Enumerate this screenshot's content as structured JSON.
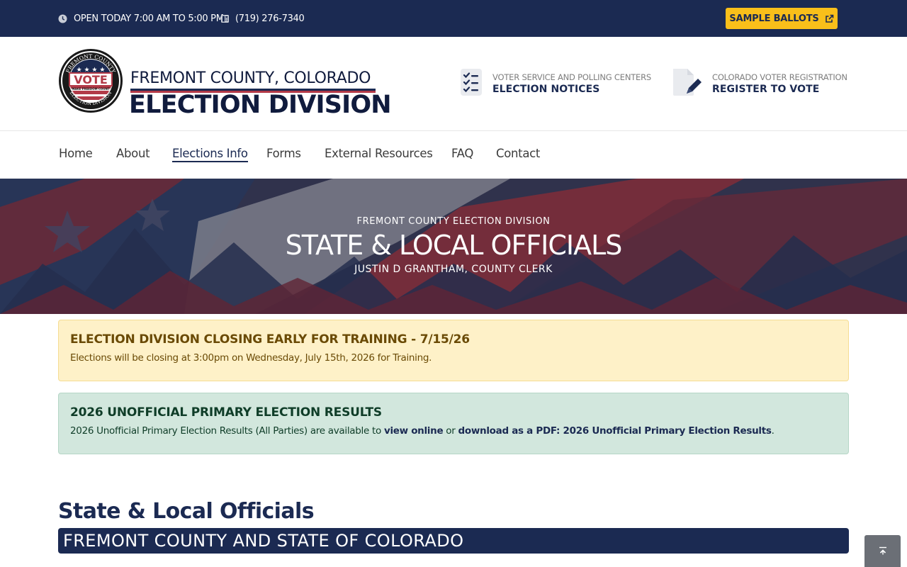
{
  "topbar": {
    "hours": "OPEN TODAY 7:00 AM TO 5:00 PM",
    "phone": "(719) 276-7340",
    "sample_ballots": "SAMPLE BALLOTS",
    "clock_icon": "clock-icon",
    "phone_icon": "phone-icon",
    "external_icon": "external-link-icon"
  },
  "header": {
    "seal": {
      "top_text": "FREMONT COUNTY",
      "vote": "VOTE",
      "motto": "MAKE FREEDOM COUNT",
      "bottom_text": "ELECTION DIVISION"
    },
    "logo_line1": "FREMONT COUNTY, COLORADO",
    "logo_line2": "ELECTION DIVISION",
    "notices": {
      "caption": "VOTER SERVICE AND POLLING CENTERS",
      "label": "ELECTION NOTICES",
      "icon": "checklist-icon"
    },
    "register": {
      "caption": "COLORADO VOTER REGISTRATION",
      "label": "REGISTER TO VOTE",
      "icon": "document-pen-icon"
    }
  },
  "nav": {
    "items": [
      "Home",
      "About",
      "Elections Info",
      "Forms",
      "External Resources",
      "FAQ",
      "Contact"
    ],
    "active": "Elections Info"
  },
  "hero": {
    "kicker": "FREMONT COUNTY ELECTION DIVISION",
    "title": "STATE & LOCAL OFFICIALS",
    "subtitle": "JUSTIN D GRANTHAM, COUNTY CLERK"
  },
  "alerts": [
    {
      "type": "warning",
      "title": "ELECTION DIVISION CLOSING EARLY FOR TRAINING - 7/15/26",
      "text": "Elections will be closing at 3:00pm on Wednesday, July 15th, 2026 for Training."
    },
    {
      "type": "success",
      "title": "2026 UNOFFICIAL PRIMARY ELECTION RESULTS",
      "text_before": "2026 Unofficial Primary Election Results (All Parties) are available to ",
      "link1": "view online",
      "text_mid": " or ",
      "link2": "download as a PDF: 2026 Unofficial Primary Election Results",
      "text_after": "."
    }
  ],
  "content": {
    "heading": "State & Local Officials",
    "band": "FREMONT COUNTY AND STATE OF COLORADO"
  },
  "back_to_top_icon": "chevron-up-icon",
  "colors": {
    "navy": "#1b2a52",
    "gold": "#f9bf1a",
    "red": "#b23a48",
    "warning_bg": "#fef1c8",
    "success_bg": "#d2e7dd"
  }
}
